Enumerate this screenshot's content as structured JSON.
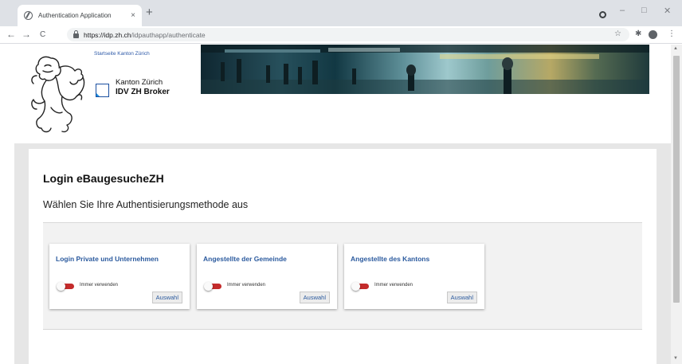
{
  "browser": {
    "tab_title": "Authentication Application",
    "tab_close": "×",
    "new_tab": "+",
    "url_host": "https://idp.zh.ch",
    "url_path": "/idpauthapp/authenticate",
    "back": "←",
    "forward": "→",
    "reload": "C",
    "star": "☆",
    "extensions": "✱",
    "menu": "⋮",
    "minimize": "–",
    "maximize": "□",
    "close": "✕"
  },
  "header": {
    "startseite_link": "Startseite Kanton Zürich",
    "canton_name": "Kanton Zürich",
    "broker_name": "IDV ZH Broker"
  },
  "main": {
    "title": "Login eBaugesucheZH",
    "subtitle": "Wählen Sie Ihre Authentisierungsmethode aus"
  },
  "cards": [
    {
      "title": "Login Private und Unternehmen",
      "toggle_label": "Immer verwenden",
      "button_label": "Auswahl"
    },
    {
      "title": "Angestellte der Gemeinde",
      "toggle_label": "Immer verwenden",
      "button_label": "Auswahl"
    },
    {
      "title": "Angestellte des Kantons",
      "toggle_label": "Immer verwenden",
      "button_label": "Auswahl"
    }
  ],
  "colors": {
    "link_blue": "#2b5a9e",
    "toggle_red": "#c42b2b",
    "page_bg": "#e6e6e6"
  },
  "icons": {
    "site": "globe-icon",
    "lock": "lock-icon",
    "coat_of_arms": "lion-icon",
    "canton_logo": "zh-logo-icon"
  }
}
